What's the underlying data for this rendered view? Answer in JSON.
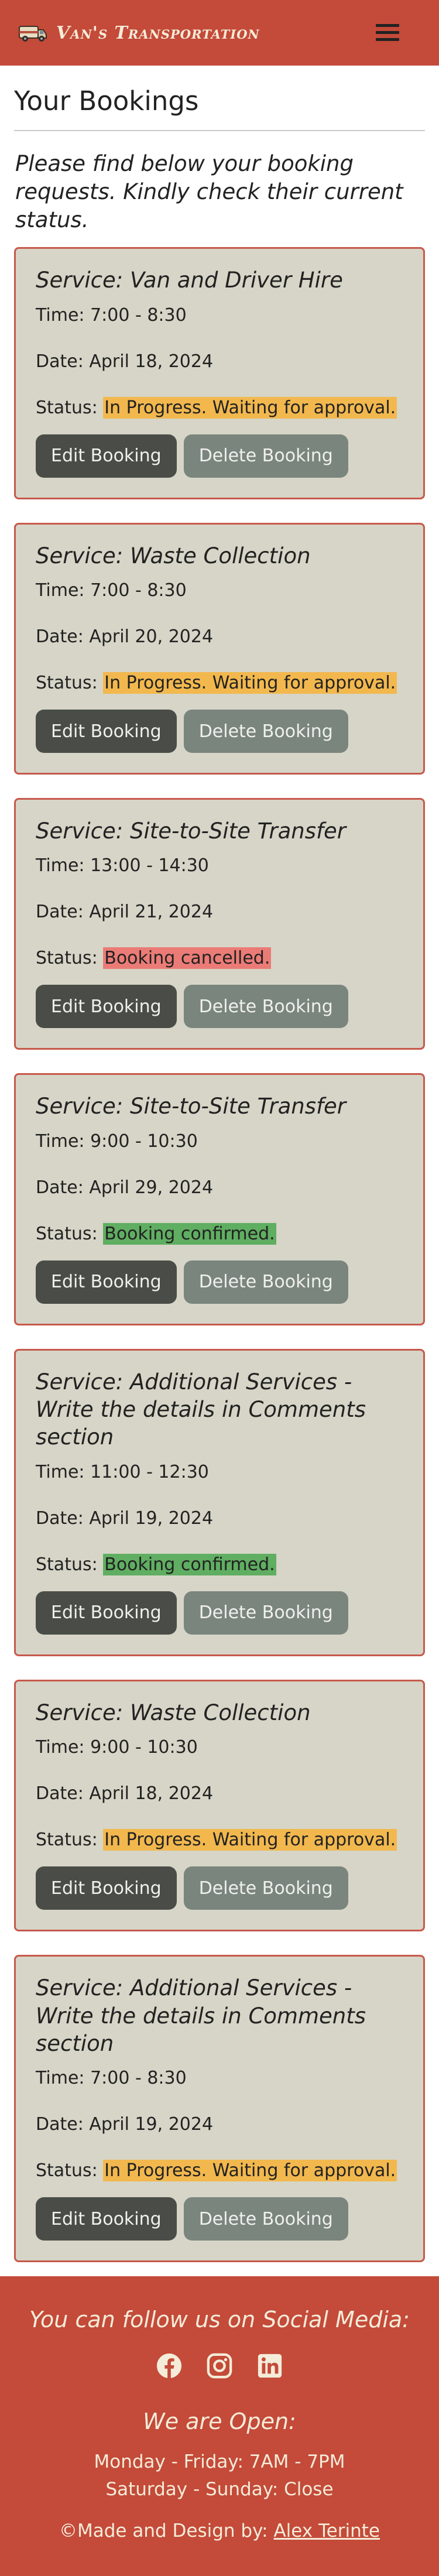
{
  "nav": {
    "brand": "Van's Transportation",
    "menu_icon": "hamburger-icon",
    "logo_icon": "van-icon"
  },
  "page": {
    "title": "Your Bookings",
    "intro": "Please find below your booking requests. Kindly check their current status."
  },
  "labels": {
    "time": "Time:",
    "date": "Date:",
    "status": "Status:",
    "edit": "Edit Booking",
    "delete": "Delete Booking"
  },
  "bookings": [
    {
      "service": "Service: Van and Driver Hire",
      "time": "7:00 - 8:30",
      "date": "April 18, 2024",
      "status": "In Progress. Waiting for approval.",
      "status_type": "pending"
    },
    {
      "service": "Service: Waste Collection",
      "time": "7:00 - 8:30",
      "date": "April 20, 2024",
      "status": "In Progress. Waiting for approval.",
      "status_type": "pending"
    },
    {
      "service": "Service: Site-to-Site Transfer",
      "time": "13:00 - 14:30",
      "date": "April 21, 2024",
      "status": "Booking cancelled.",
      "status_type": "cancelled"
    },
    {
      "service": "Service: Site-to-Site Transfer",
      "time": "9:00 - 10:30",
      "date": "April 29, 2024",
      "status": "Booking confirmed.",
      "status_type": "confirmed"
    },
    {
      "service": "Service: Additional Services - Write the details in Comments section",
      "time": "11:00 - 12:30",
      "date": "April 19, 2024",
      "status": "Booking confirmed.",
      "status_type": "confirmed"
    },
    {
      "service": "Service: Waste Collection",
      "time": "9:00 - 10:30",
      "date": "April 18, 2024",
      "status": "In Progress. Waiting for approval.",
      "status_type": "pending"
    },
    {
      "service": "Service: Additional Services - Write the details in Comments section",
      "time": "7:00 - 8:30",
      "date": "April 19, 2024",
      "status": "In Progress. Waiting for approval.",
      "status_type": "pending"
    }
  ],
  "footer": {
    "follow": "You can follow us on Social Media:",
    "social_icons": [
      "facebook-icon",
      "instagram-icon",
      "linkedin-icon"
    ],
    "open_heading": "We are Open:",
    "hours_weekday": "Monday - Friday: 7AM - 7PM",
    "hours_weekend": "Saturday - Sunday: Close",
    "credit_prefix": "©Made and Design by:",
    "credit_name": "Alex Terinte"
  },
  "colors": {
    "brand": "#c44a39",
    "card_bg": "#d6d5c7",
    "card_border": "#c7594b",
    "pending": "#f2b84e",
    "cancelled": "#eb7b76",
    "confirmed": "#5fae61",
    "edit_btn": "#4a4d47",
    "delete_btn": "#7a857e"
  }
}
